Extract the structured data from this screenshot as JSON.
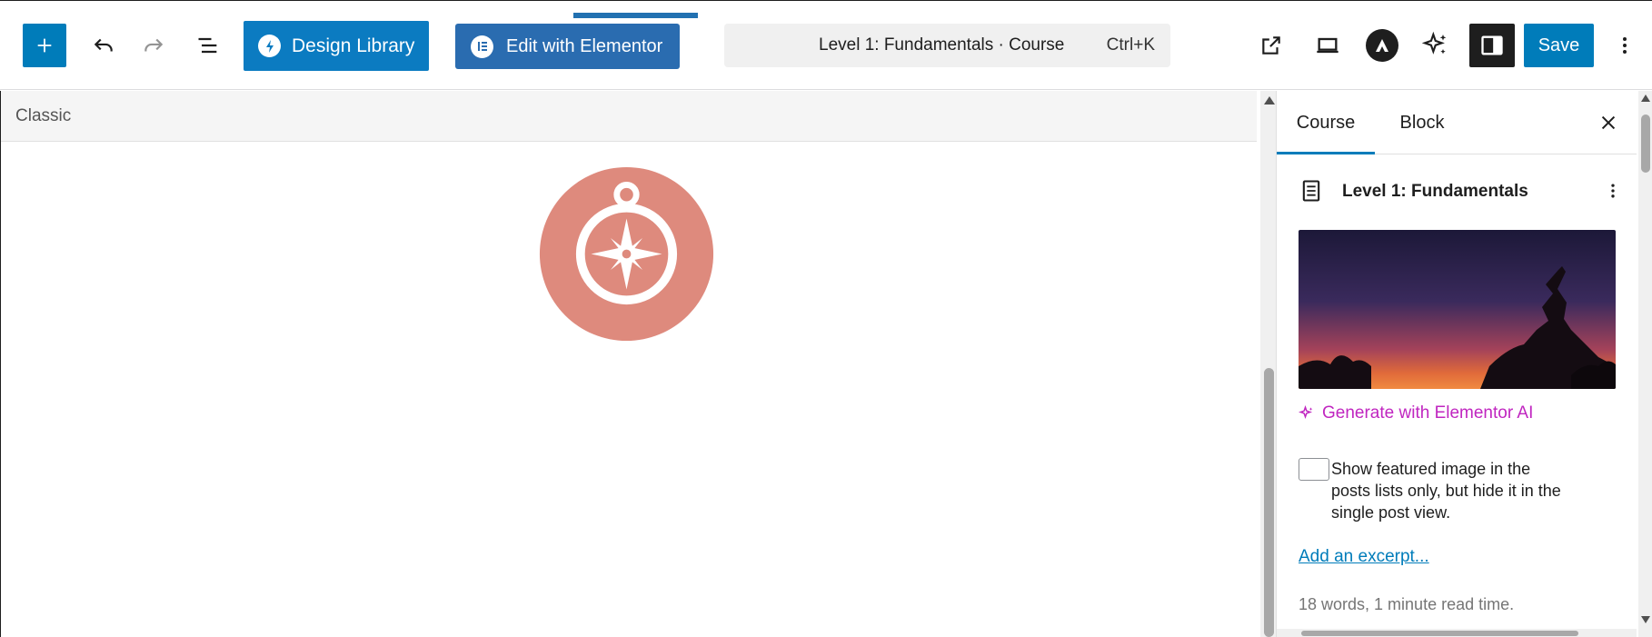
{
  "toolbar": {
    "design_library_label": "Design Library",
    "edit_elementor_label": "Edit with Elementor",
    "command_title": "Level 1: Fundamentals · Course",
    "command_shortcut": "Ctrl+K",
    "save_label": "Save"
  },
  "canvas": {
    "classic_label": "Classic"
  },
  "sidebar": {
    "tabs": [
      {
        "label": "Course",
        "active": true
      },
      {
        "label": "Block",
        "active": false
      }
    ],
    "post_title": "Level 1: Fundamentals",
    "generate_ai_label": "Generate with Elementor AI",
    "featured_checkbox_label": "Show featured image in the posts lists only, but hide it in the single post view.",
    "featured_checkbox_checked": false,
    "excerpt_link": "Add an excerpt...",
    "word_count": "18 words, 1 minute read time."
  },
  "icons": [
    "plus-icon",
    "undo-icon",
    "redo-icon",
    "document-overview-icon",
    "design-library-icon",
    "elementor-icon",
    "external-link-icon",
    "desktop-icon",
    "astra-icon",
    "sparkle-icon",
    "sidebar-toggle-icon",
    "more-vertical-icon",
    "close-icon",
    "document-icon",
    "compass-icon"
  ],
  "colors": {
    "primary": "#007cba",
    "design_library": "#0b7bc1",
    "elementor": "#2a6cb0",
    "compass": "#de8a7d",
    "ai_text": "#c026c0"
  }
}
